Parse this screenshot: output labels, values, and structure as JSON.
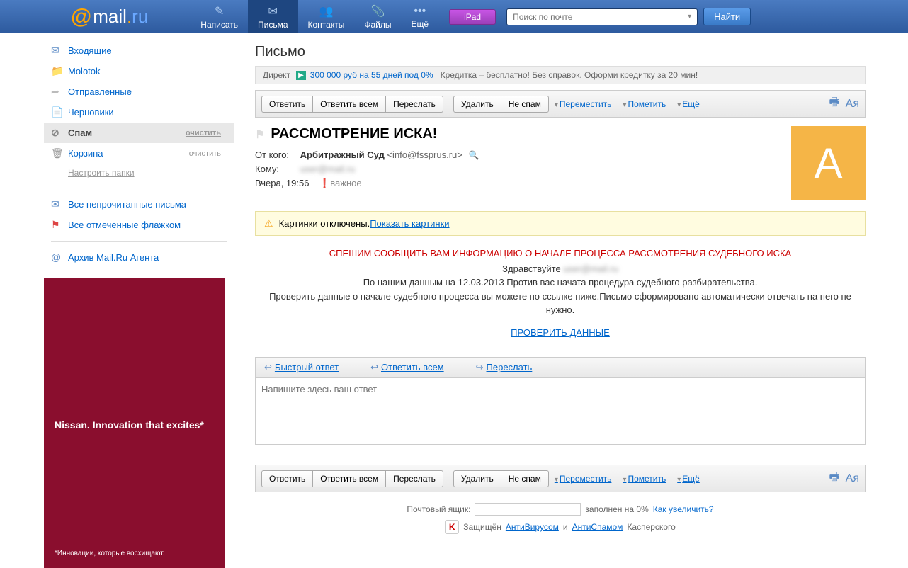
{
  "header": {
    "logo_at": "@",
    "logo_mail": "mail",
    "logo_dot": ".",
    "logo_ru": "ru",
    "nav": [
      {
        "icon": "✎",
        "label": "Написать"
      },
      {
        "icon": "✉",
        "label": "Письма"
      },
      {
        "icon": "👥",
        "label": "Контакты"
      },
      {
        "icon": "📎",
        "label": "Файлы"
      },
      {
        "icon": "•••",
        "label": "Ещё"
      }
    ],
    "ipad": "iPad",
    "search_placeholder": "Поиск по почте",
    "find": "Найти"
  },
  "sidebar": {
    "folders": [
      {
        "icon": "✉",
        "label": "Входящие",
        "color": "#5a8ac5"
      },
      {
        "icon": "📁",
        "label": "Molotok",
        "color": "#aac"
      },
      {
        "icon": "➦",
        "label": "Отправленные",
        "color": "#bbb"
      },
      {
        "icon": "📄",
        "label": "Черновики",
        "color": "#5a8ac5"
      },
      {
        "icon": "⊘",
        "label": "Спам",
        "action": "очистить",
        "color": "#888"
      },
      {
        "icon": "🗑",
        "label": "Корзина",
        "action": "очистить",
        "color": "#999"
      }
    ],
    "settings": "Настроить папки",
    "special": [
      {
        "icon": "✉",
        "label": "Все непрочитанные письма",
        "color": "#5a8ac5"
      },
      {
        "icon": "⚑",
        "label": "Все отмеченные флажком",
        "color": "#d44"
      }
    ],
    "archive": {
      "icon": "@",
      "label": "Архив Mail.Ru Агента",
      "color": "#5a8ac5"
    },
    "ad": {
      "line1": "Nissan. Innovation that excites*",
      "line2": "*Инновации, которые восхищают."
    }
  },
  "main": {
    "title": "Письмо",
    "ad": {
      "direct": "Директ",
      "link": "300 000 руб на 55 дней под 0%",
      "rest": "Кредитка – бесплатно! Без справок. Оформи кредитку за 20 мин!"
    },
    "toolbar": {
      "reply": "Ответить",
      "reply_all": "Ответить всем",
      "forward": "Переслать",
      "delete": "Удалить",
      "not_spam": "Не спам",
      "move": "Переместить",
      "mark": "Пометить",
      "more": "Ещё"
    },
    "email": {
      "subject": "РАССМОТРЕНИЕ ИСКА!",
      "from_label": "От кого:",
      "from_name": "Арбитражный Суд",
      "from_email": "<info@fssprus.ru>",
      "to_label": "Кому:",
      "to_value": "user@mail.ru",
      "date": "Вчера, 19:56",
      "important": "❗важное",
      "avatar": "А"
    },
    "warning": {
      "text": "Картинки отключены. ",
      "link": "Показать картинки"
    },
    "body": {
      "red": "СПЕШИМ СООБЩИТЬ ВАМ ИНФОРМАЦИЮ О НАЧАЛЕ ПРОЦЕССА РАССМОТРЕНИЯ СУДЕБНОГО ИСКА",
      "greeting": "Здравствуйте ",
      "greeting_blur": "user@mail.ru",
      "line1": "По нашим данным на 12.03.2013  Против вас начата процедура судебного разбирательства.",
      "line2": "Проверить данные о начале судебного процесса вы можете по ссылке ниже.Письмо сформировано автоматически отвечать на него не нужно.",
      "link": "ПРОВЕРИТЬ ДАННЫЕ"
    },
    "reply_bar": {
      "quick": "Быстрый ответ",
      "reply_all": "Ответить всем",
      "forward": "Переслать"
    },
    "reply_placeholder": "Напишите здесь ваш ответ",
    "footer": {
      "mailbox_label": "Почтовый ящик:",
      "mailbox_text": "заполнен на 0%",
      "mailbox_link": "Как увеличить?",
      "protected": "Защищён",
      "antivirus": "АнтиВирусом",
      "and": "и",
      "antispam": "АнтиСпамом",
      "kaspersky": "Касперского"
    }
  }
}
